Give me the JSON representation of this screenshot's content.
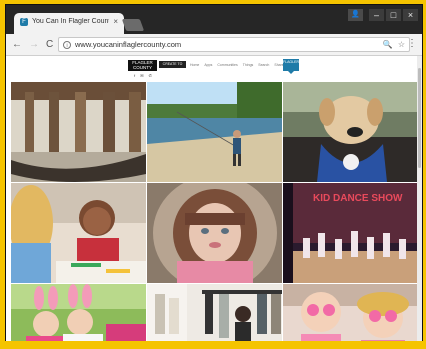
{
  "browser": {
    "tab_title": "You Can In Flagler County",
    "tab_favicon": "F",
    "tab_close": "×",
    "nav": {
      "back": "←",
      "forward": "→",
      "reload": "C"
    },
    "url": "www.youcaninflaglercounty.com",
    "omnibox_icons": {
      "zoom": "🔍",
      "star": "☆"
    },
    "menu": "⋮",
    "window_controls": {
      "profile": "👤",
      "minimize": "–",
      "maximize": "□",
      "close": "×"
    }
  },
  "site": {
    "logo_text": "FLAGLER COUNTY",
    "logo_social": "f ✉ ✆",
    "header_button": "CREATE TO CONF",
    "nav_links": [
      "Home",
      "Apps",
      "Communities",
      "Things",
      "Search",
      "Share"
    ],
    "badge": "FLAGLER",
    "photo_text": "KID DANCE SHOW"
  },
  "colors": {
    "brand_blue": "#1f7ba8",
    "desktop_yellow": "#f5c400"
  }
}
